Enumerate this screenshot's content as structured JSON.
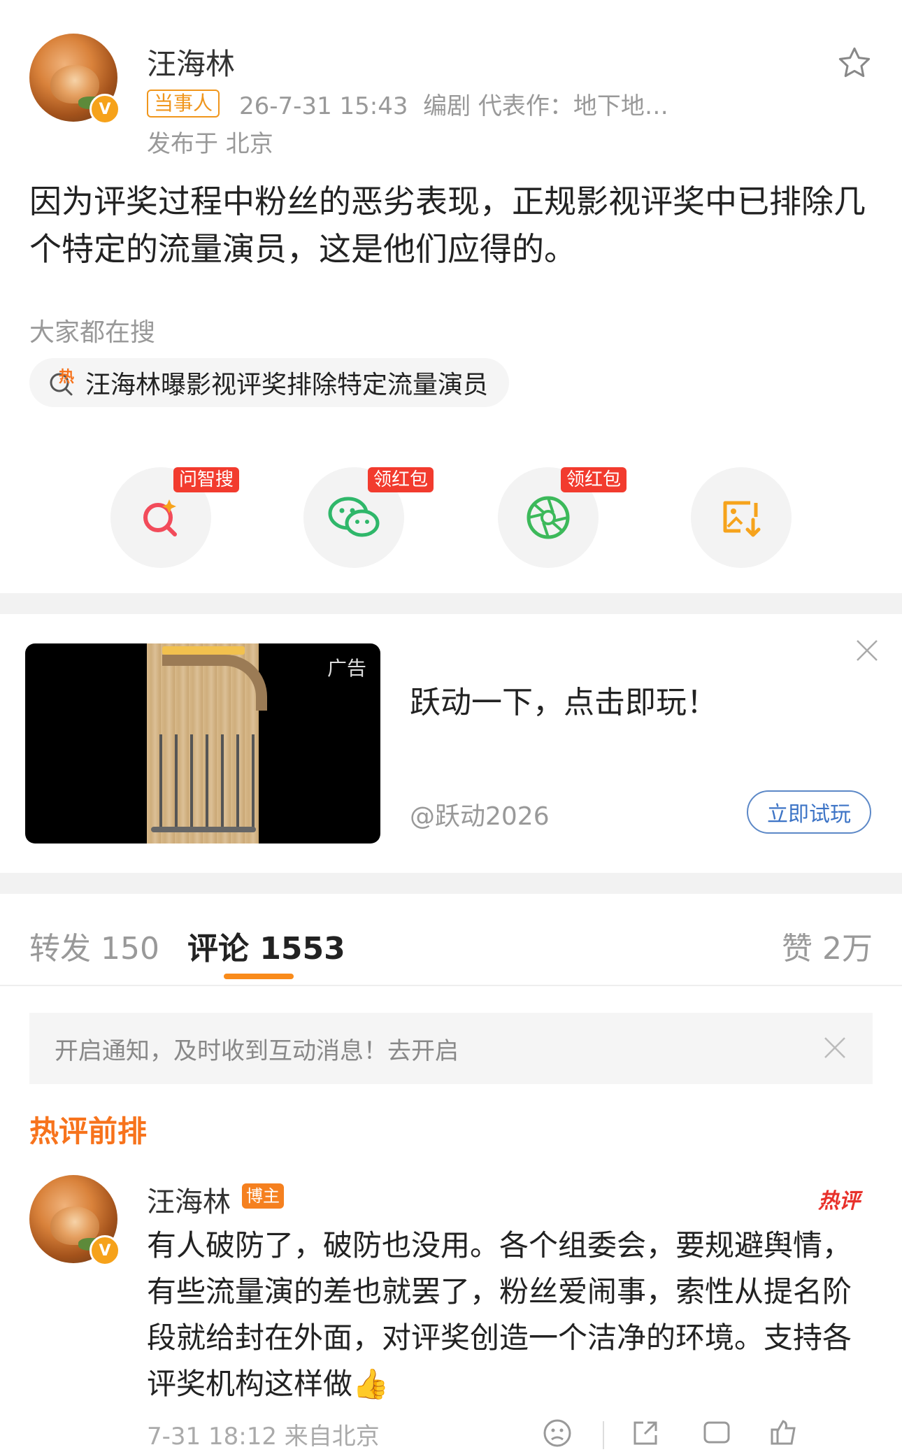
{
  "post": {
    "author": "汪海林",
    "tag": "当事人",
    "meta": "26-7-31 15:43  编剧 代表作：地下地…",
    "location": "发布于 北京",
    "text": "因为评奖过程中粉丝的恶劣表现，正规影视评奖中已排除几个特定的流量演员，这是他们应得的。",
    "verified_badge": "V"
  },
  "search": {
    "label": "大家都在搜",
    "chip": "汪海林曝影视评奖排除特定流量演员",
    "hot_char": "热"
  },
  "actions": [
    {
      "icon": "ask-search-icon",
      "tag": "问智搜"
    },
    {
      "icon": "wechat-icon",
      "tag": "领红包"
    },
    {
      "icon": "moments-icon",
      "tag": "领红包"
    },
    {
      "icon": "save-image-icon",
      "tag": ""
    }
  ],
  "ad": {
    "badge": "广告",
    "title": "跃动一下，点击即玩！",
    "author": "@跃动2026",
    "button": "立即试玩"
  },
  "tabs": {
    "repost": "转发 150",
    "comments": "评论 1553",
    "likes": "赞 2万"
  },
  "notice": {
    "text": "开启通知，及时收到互动消息！去开启"
  },
  "hot_comments": {
    "heading": "热评前排",
    "items": [
      {
        "author": "汪海林",
        "badge": "博主",
        "hot_label": "热评",
        "text": "有人破防了，破防也没用。各个组委会，要规避舆情，有些流量演的差也就罢了，粉丝爱闹事，索性从提名阶段就给封在外面，对评奖创造一个洁净的环境。支持各评奖机构这样做👍",
        "time": "7-31 18:12 来自北京"
      }
    ]
  },
  "colors": {
    "accent_orange": "#f98b1b",
    "red_tag": "#f23b2e",
    "link_blue": "#3d74c6"
  }
}
